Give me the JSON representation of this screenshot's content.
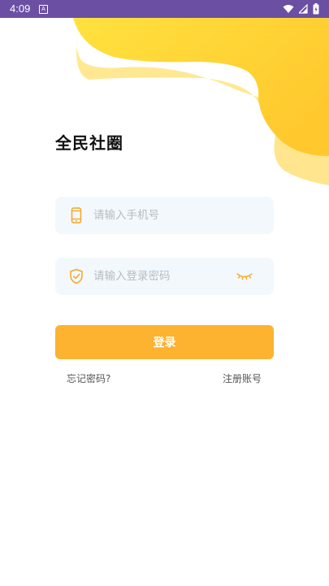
{
  "status_bar": {
    "time": "4:09",
    "notification_icon": "A",
    "icons": [
      "wifi-icon",
      "signal-icon",
      "battery-icon"
    ]
  },
  "app": {
    "title": "全民社圈"
  },
  "form": {
    "phone_placeholder": "请输入手机号",
    "password_placeholder": "请输入登录密码",
    "login_label": "登录",
    "forgot_password_label": "忘记密码?",
    "register_label": "注册账号"
  },
  "colors": {
    "status_bar": "#6b4fa3",
    "accent": "#fdb230",
    "field_bg": "#f3f8fc",
    "blob_yellow": "#ffd93b"
  }
}
